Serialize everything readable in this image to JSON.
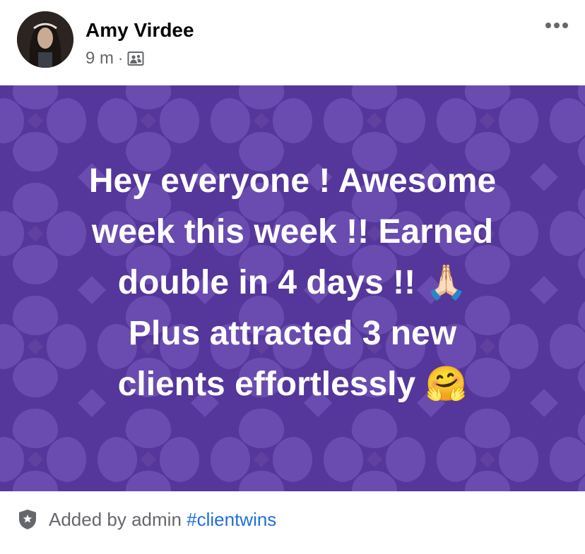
{
  "post": {
    "author": "Amy Virdee",
    "time": "9 m",
    "separator": "·",
    "audience_icon": "group-photo-icon",
    "more_icon": "more-dots-icon",
    "text": "Hey everyone ! Awesome\nweek this week !! Earned\ndouble in 4 days !! 🙏🏻\nPlus attracted  3 new\nclients effortlessly 🤗",
    "background_color": "#55369a",
    "pattern_color": "#6a4cb0",
    "text_color": "#ffffff"
  },
  "footer": {
    "badge_icon": "admin-shield-icon",
    "added_by": "Added by admin",
    "hashtag": "#clientwins",
    "hashtag_color": "#216fdb"
  }
}
